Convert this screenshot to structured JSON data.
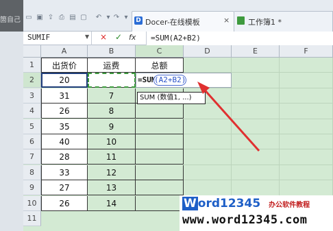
{
  "window": {
    "left_cut_text": "箇自己",
    "tabs": [
      {
        "label": "Docer-在线模板",
        "close": "×"
      },
      {
        "label": "工作簿1 *"
      }
    ]
  },
  "formula_bar": {
    "name_box": "SUMIF",
    "cancel": "×",
    "enter": "✓",
    "fx": "fx",
    "formula": "=SUM(A2+B2)"
  },
  "sheet": {
    "columns": [
      "A",
      "B",
      "C",
      "D",
      "E",
      "F"
    ],
    "rows": [
      "1",
      "2",
      "3",
      "4",
      "5",
      "6",
      "7",
      "8",
      "9",
      "10",
      "11"
    ],
    "headers": {
      "A1": "出货价",
      "B1": "运费",
      "C1": "总额"
    },
    "col_a": [
      "20",
      "31",
      "26",
      "35",
      "40",
      "28",
      "33",
      "27",
      "26"
    ],
    "col_b": [
      "",
      "7",
      "8",
      "9",
      "10",
      "11",
      "12",
      "13",
      "14"
    ],
    "editing": {
      "cell": "C2",
      "func": "=SUM",
      "ref": "(A2+B2)"
    },
    "tooltip": "SUM (数值1, ...)"
  },
  "watermark": {
    "brand_w": "W",
    "brand_ord": "ord",
    "brand_num": "12345",
    "tagline": "办公软件教程",
    "url": "www.word12345.com"
  },
  "colors": {
    "accent_red": "#e03030",
    "selection_border": "#1f3d7a",
    "marquee": "#3c9a3c",
    "grid_fill": "#d3ead3"
  }
}
